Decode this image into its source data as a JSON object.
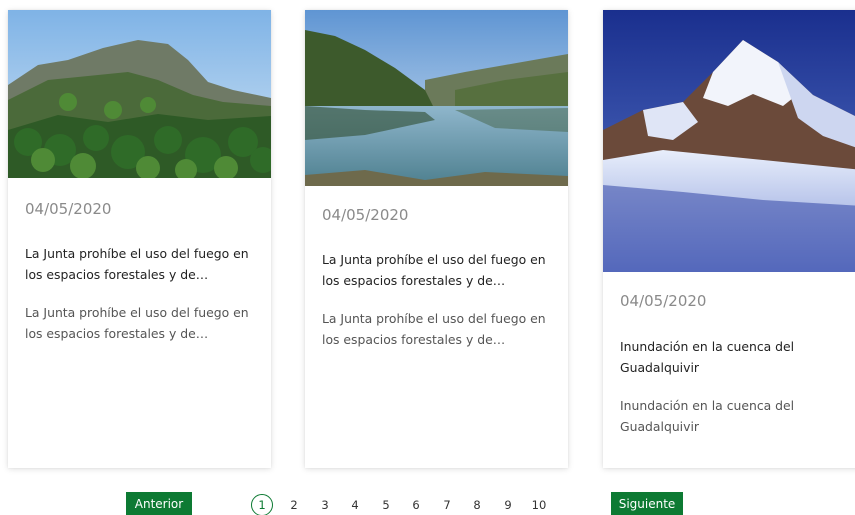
{
  "cards": [
    {
      "image": "forest-hillside-photo",
      "date": "04/05/2020",
      "title": "La Junta prohíbe el uso del fuego en los espacios forestales y de influencia forestal",
      "description": "La Junta prohíbe el uso del fuego en los espacios forestales y de influencia forestal"
    },
    {
      "image": "reservoir-lake-photo",
      "date": "04/05/2020",
      "title": "La Junta prohíbe el uso del fuego en los espacios forestales y de influencia forestal",
      "description": "La Junta prohíbe el uso del fuego en los espacios forestales y de influencia forestal"
    },
    {
      "image": "snowy-mountain-photo",
      "date": "04/05/2020",
      "title": "Inundación en la cuenca del Guadalquivir",
      "description": "Inundación en la cuenca del Guadalquivir"
    }
  ],
  "pagination": {
    "prev_label": "Anterior",
    "next_label": "Siguiente",
    "current_page": "1",
    "pages": [
      "1",
      "2",
      "3",
      "4",
      "5",
      "6",
      "7",
      "8",
      "9",
      "10"
    ]
  },
  "colors": {
    "accent": "#0d7a33",
    "date_text": "#8a8a8a"
  }
}
